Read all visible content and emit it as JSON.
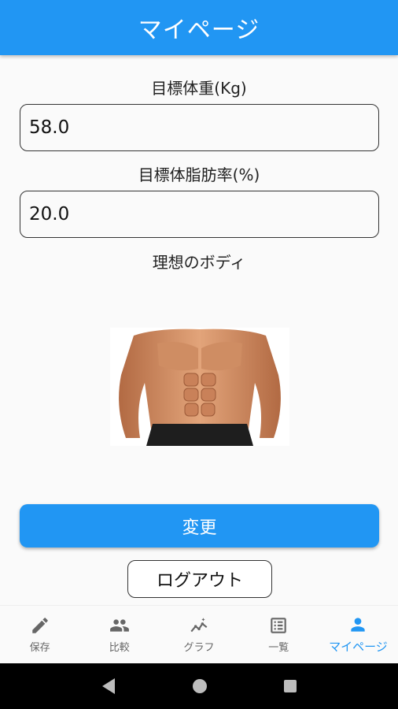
{
  "app_bar": {
    "title": "マイページ"
  },
  "form": {
    "target_weight_label": "目標体重(Kg)",
    "target_weight_value": "58.0",
    "target_body_fat_label": "目標体脂肪率(%)",
    "target_body_fat_value": "20.0",
    "ideal_body_label": "理想のボディ"
  },
  "buttons": {
    "change": "変更",
    "logout": "ログアウト"
  },
  "bottom_nav": {
    "items": [
      {
        "label": "保存",
        "icon": "pencil-icon"
      },
      {
        "label": "比較",
        "icon": "people-icon"
      },
      {
        "label": "グラフ",
        "icon": "chart-icon"
      },
      {
        "label": "一覧",
        "icon": "list-icon"
      },
      {
        "label": "マイページ",
        "icon": "person-icon"
      }
    ],
    "active_index": 4
  },
  "colors": {
    "primary": "#2196f3",
    "inactive": "#666666"
  }
}
